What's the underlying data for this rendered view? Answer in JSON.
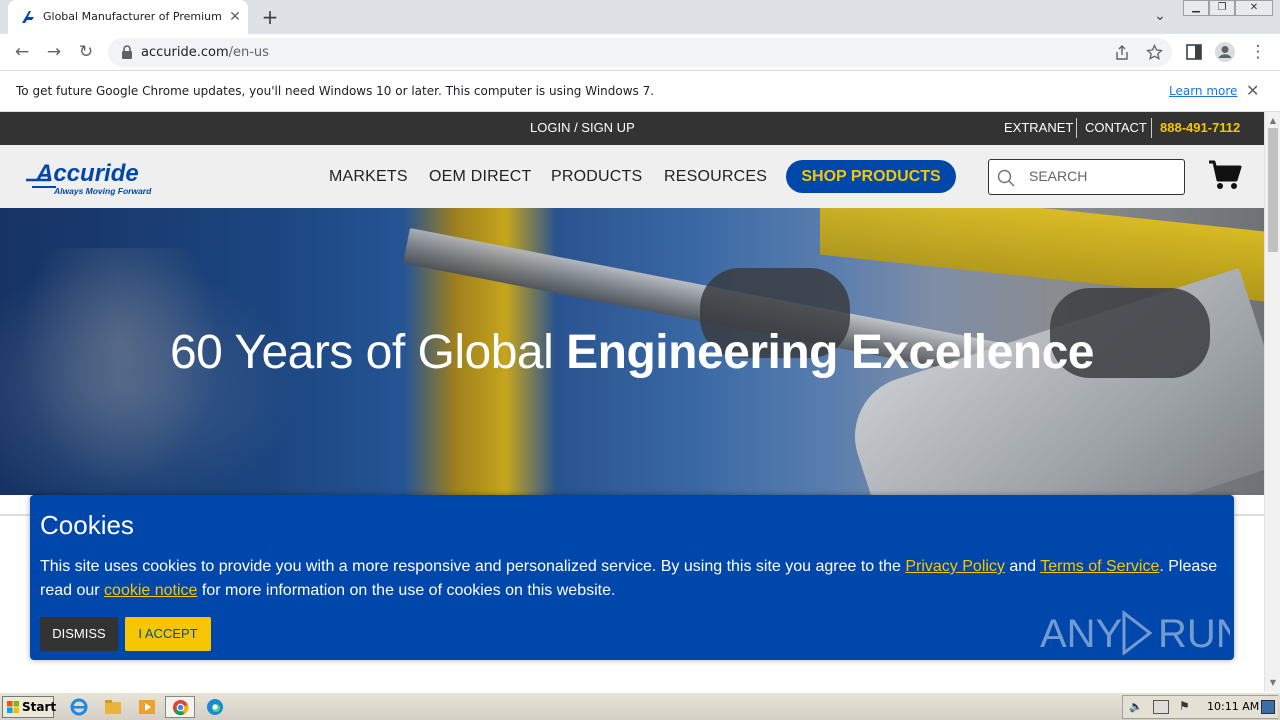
{
  "browser": {
    "tab_title": "Global Manufacturer of Premium Ball",
    "tab_close": "✕",
    "new_tab": "+",
    "url_host": "accuride.com",
    "url_path": "/en-us",
    "infobar_text": "To get future Google Chrome updates, you'll need Windows 10 or later. This computer is using Windows 7.",
    "infobar_link": "Learn more",
    "infobar_close": "✕"
  },
  "topbar": {
    "login": "LOGIN / SIGN UP",
    "extranet": "EXTRANET",
    "contact": "CONTACT",
    "phone": "888-491-7112"
  },
  "header": {
    "logo_text": "Accuride",
    "logo_tagline": "Always Moving Forward",
    "nav": [
      "MARKETS",
      "OEM DIRECT",
      "PRODUCTS",
      "RESOURCES"
    ],
    "shop": "SHOP PRODUCTS",
    "search_placeholder": "SEARCH"
  },
  "hero": {
    "title_light": "60 Years of Global ",
    "title_bold": "Engineering Excellence"
  },
  "cookie": {
    "title": "Cookies",
    "text_1": "This site uses cookies to provide you with a more responsive and personalized service. By using this site you agree to the ",
    "privacy_link": "Privacy Policy",
    "text_2": " and ",
    "terms_link": "Terms of Service",
    "text_3": ". Please read our ",
    "notice_link": "cookie notice",
    "text_4": " for more information on the use of cookies on this website.",
    "dismiss": "DISMISS",
    "accept": "I ACCEPT",
    "watermark": "ANY RUN"
  },
  "taskbar": {
    "start": "Start",
    "clock": "10:11 AM"
  },
  "colors": {
    "brand_blue": "#0047ab",
    "brand_yellow": "#f6c700",
    "topbar_bg": "#333333"
  }
}
